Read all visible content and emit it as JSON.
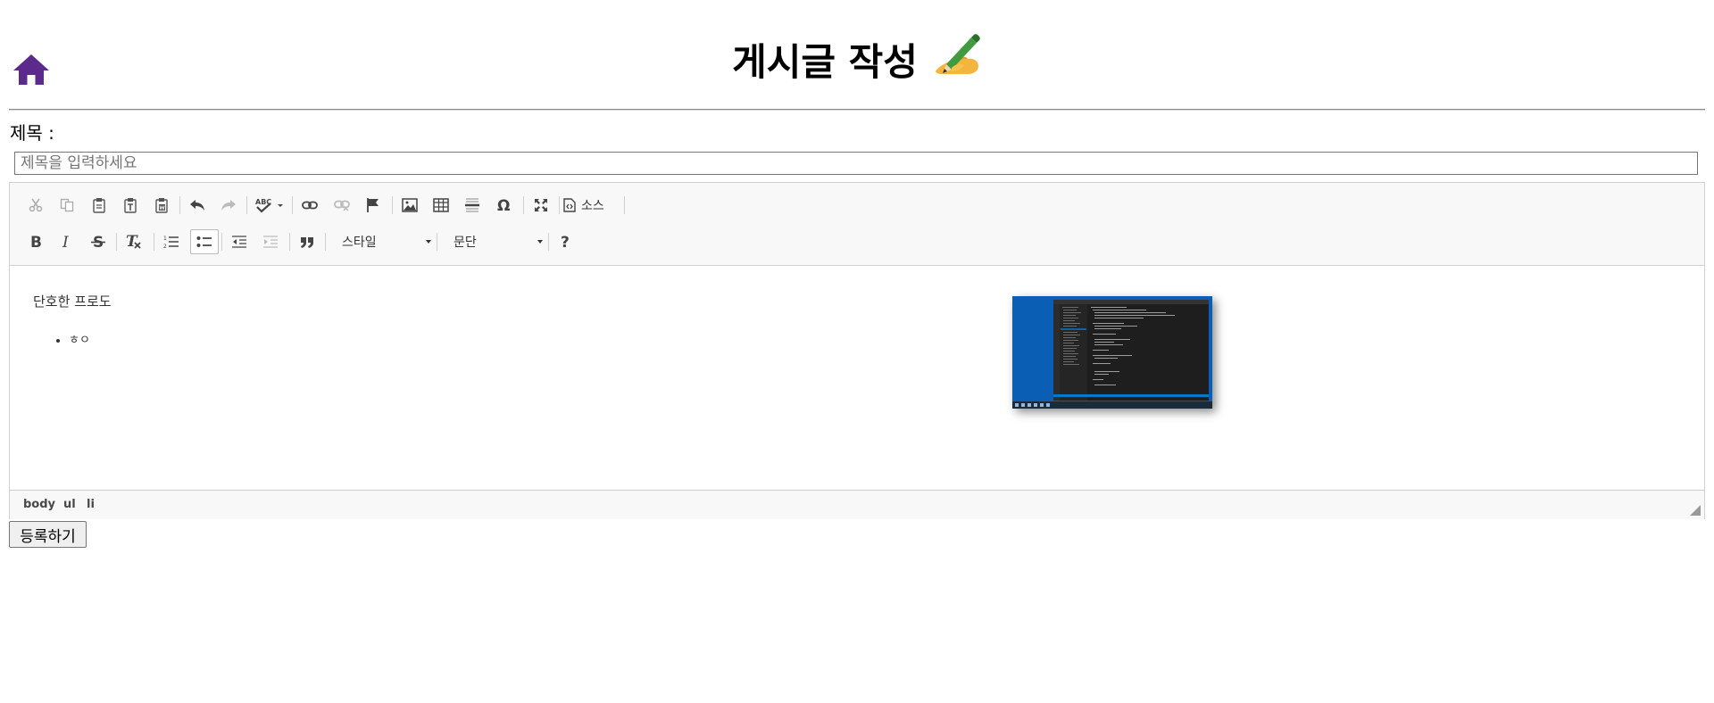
{
  "header": {
    "title": "게시글 작성",
    "home_icon": "home-icon",
    "title_emoji": "writing-hand-icon"
  },
  "form": {
    "subject_label": "제목 :",
    "subject_placeholder": "제목을 입력하세요",
    "subject_value": "",
    "submit_label": "등록하기"
  },
  "toolbar": {
    "row1": [
      "cut-icon",
      "copy-icon",
      "paste-icon",
      "paste-text-icon",
      "paste-from-word-icon",
      "undo-icon",
      "redo-icon",
      "spellcheck-icon",
      "link-icon",
      "unlink-icon",
      "anchor-icon",
      "image-icon",
      "table-icon",
      "horizontal-line-icon",
      "special-char-icon",
      "maximize-icon"
    ],
    "source_label": "소스",
    "row2": [
      "bold-icon",
      "italic-icon",
      "strike-icon",
      "remove-format-icon",
      "numbered-list-icon",
      "bulleted-list-icon",
      "outdent-icon",
      "indent-icon",
      "blockquote-icon",
      "help-icon"
    ],
    "style_combo": "스타일",
    "format_combo": "문단"
  },
  "content": {
    "paragraph": "단호한 프로도",
    "list_items": [
      "ㅎㅇ"
    ]
  },
  "statusbar": {
    "path": [
      "body",
      "ul",
      "li"
    ]
  },
  "colors": {
    "home_icon": "#5b2a8c",
    "image_bg": "#0a5fb4",
    "toolbar_bg": "#f8f8f8"
  }
}
